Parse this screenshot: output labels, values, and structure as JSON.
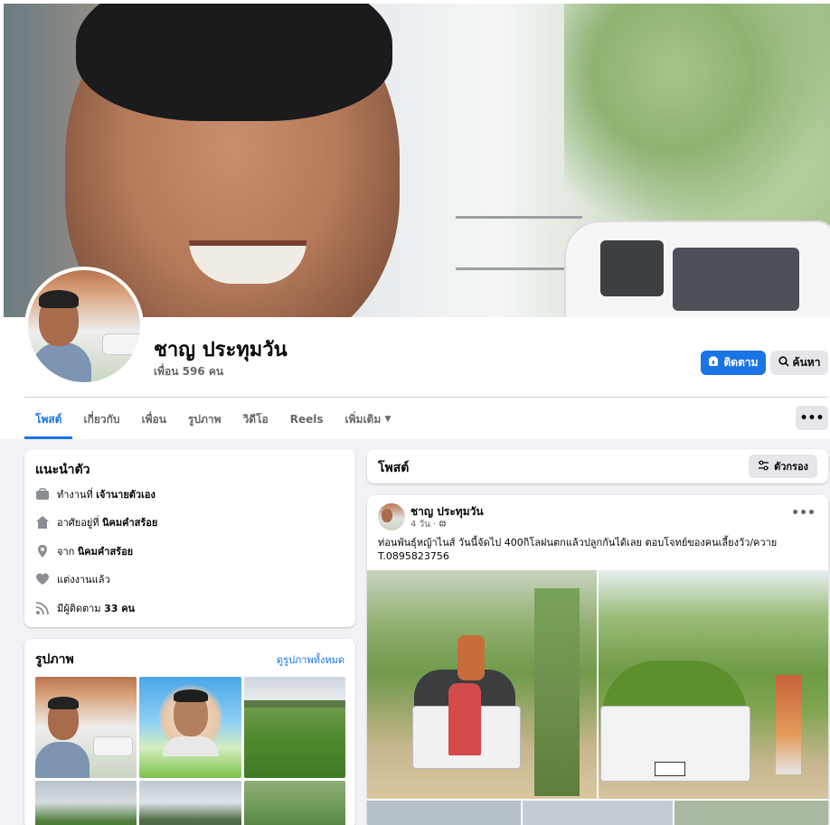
{
  "profile": {
    "name": "ชาญ ประทุมวัน",
    "friends": "เพื่อน 596 คน",
    "follow_label": "ติดตาม",
    "search_label": "ค้นหา"
  },
  "tabs": [
    {
      "label": "โพสต์",
      "active": true
    },
    {
      "label": "เกี่ยวกับ"
    },
    {
      "label": "เพื่อน"
    },
    {
      "label": "รูปภาพ"
    },
    {
      "label": "วิดีโอ"
    },
    {
      "label": "Reels"
    },
    {
      "label": "เพิ่มเติม"
    }
  ],
  "tab_more_icon": "more-dots-icon",
  "intro": {
    "title": "แนะนำตัว",
    "rows": [
      {
        "icon": "briefcase-icon",
        "prefix": "ทำงานที่ ",
        "value": "เจ้านายตัวเอง"
      },
      {
        "icon": "home-icon",
        "prefix": "อาศัยอยู่ที่ ",
        "value": "นิคมคำสร้อย"
      },
      {
        "icon": "location-pin-icon",
        "prefix": "จาก ",
        "value": "นิคมคำสร้อย"
      },
      {
        "icon": "heart-icon",
        "prefix": "แต่งงานแล้ว",
        "value": ""
      },
      {
        "icon": "rss-icon",
        "prefix": "มีผู้ติดตาม ",
        "value": "33 คน"
      }
    ]
  },
  "photos": {
    "title": "รูปภาพ",
    "see_all": "ดูรูปภาพทั้งหมด"
  },
  "posts_header": {
    "title": "โพสต์",
    "filter_label": "ตัวกรอง"
  },
  "post": {
    "author": "ชาญ ประทุมวัน",
    "time": "4 วัน",
    "text": "ท่อนพันธุ์หญ้าไนส์ วันนี้จัดไป 400กิโลฝนตกแล้วปลูกกันได้เลย ตอบโจทย์ของคนเลี้ยงวัว/ควาย T.0895823756"
  }
}
